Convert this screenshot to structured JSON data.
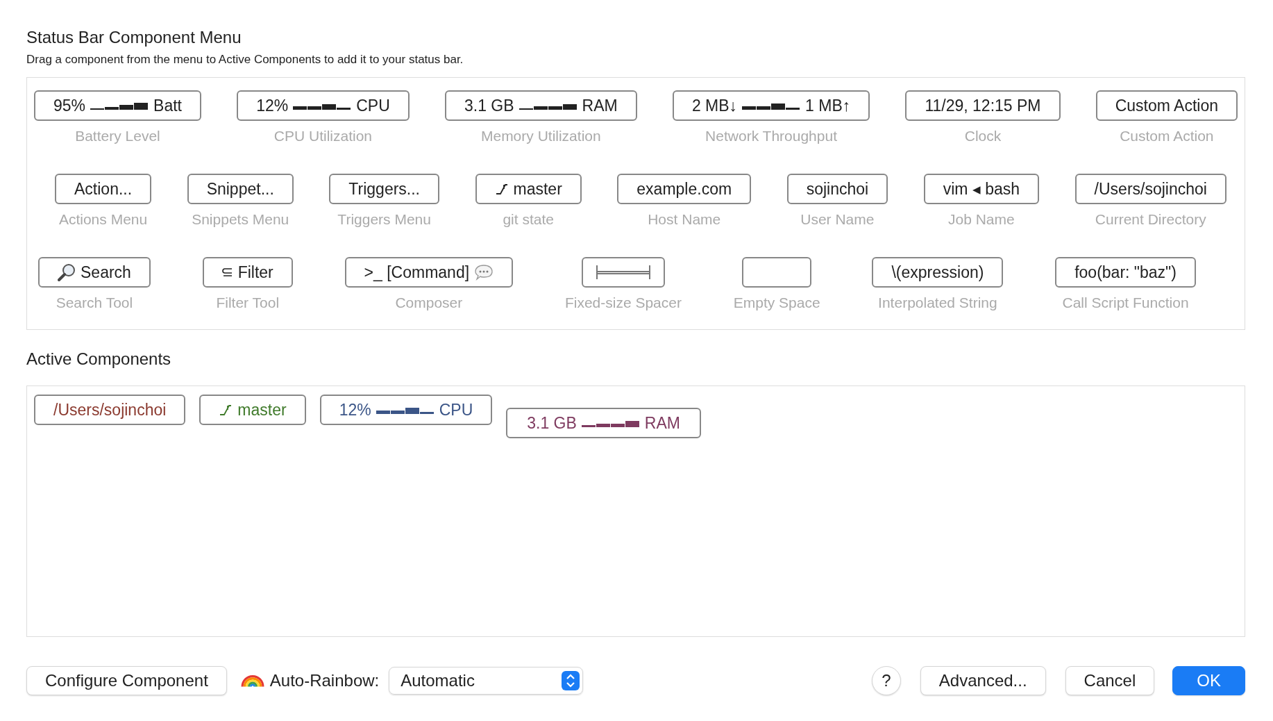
{
  "menu": {
    "title": "Status Bar Component Menu",
    "subtitle": "Drag a component from the menu to Active Components to add it to your status bar.",
    "components": [
      {
        "kind": "spark",
        "prefix": "95%",
        "suffix": "Batt",
        "caption": "Battery Level"
      },
      {
        "kind": "spark",
        "prefix": "12%",
        "suffix": "CPU",
        "caption": "CPU Utilization"
      },
      {
        "kind": "spark",
        "prefix": "3.1 GB",
        "suffix": "RAM",
        "caption": "Memory Utilization"
      },
      {
        "kind": "spark",
        "prefix": "2 MB↓",
        "suffix": "1 MB↑",
        "caption": "Network Throughput"
      },
      {
        "kind": "text",
        "text": "11/29, 12:15 PM",
        "caption": "Clock"
      },
      {
        "kind": "text",
        "text": "Custom Action",
        "caption": "Custom Action"
      },
      {
        "kind": "text",
        "text": "Action...",
        "caption": "Actions Menu"
      },
      {
        "kind": "text",
        "text": "Snippet...",
        "caption": "Snippets Menu"
      },
      {
        "kind": "text",
        "text": "Triggers...",
        "caption": "Triggers Menu"
      },
      {
        "kind": "git",
        "text": "master",
        "caption": "git state"
      },
      {
        "kind": "text",
        "text": "example.com",
        "caption": "Host Name"
      },
      {
        "kind": "text",
        "text": "sojinchoi",
        "caption": "User Name"
      },
      {
        "kind": "text",
        "text": "vim ◂ bash",
        "caption": "Job Name"
      },
      {
        "kind": "text",
        "text": "/Users/sojinchoi",
        "caption": "Current Directory"
      },
      {
        "kind": "search",
        "text": "Search",
        "caption": "Search Tool"
      },
      {
        "kind": "filter",
        "text": "Filter",
        "caption": "Filter Tool"
      },
      {
        "kind": "composer",
        "text": ">_ [Command]",
        "caption": "Composer"
      },
      {
        "kind": "spacer",
        "caption": "Fixed-size Spacer"
      },
      {
        "kind": "empty",
        "caption": "Empty Space"
      },
      {
        "kind": "text",
        "text": "\\(expression)",
        "caption": "Interpolated String"
      },
      {
        "kind": "text",
        "text": "foo(bar: \"baz\")",
        "caption": "Call Script Function"
      }
    ]
  },
  "active": {
    "title": "Active Components",
    "items": [
      {
        "kind": "text",
        "text": "/Users/sojinchoi",
        "color": "#8b3a2f"
      },
      {
        "kind": "git",
        "text": "master",
        "color": "#3f7a2a"
      },
      {
        "kind": "spark",
        "prefix": "12%",
        "suffix": "CPU",
        "color": "#3b5587"
      },
      {
        "kind": "spark",
        "prefix": "3.1 GB",
        "suffix": "RAM",
        "color": "#7e3a5f"
      }
    ]
  },
  "footer": {
    "configure": "Configure Component",
    "rainbow_label": "Auto-Rainbow:",
    "rainbow_value": "Automatic",
    "help": "?",
    "buttons": [
      {
        "label": "Advanced...",
        "primary": false
      },
      {
        "label": "Cancel",
        "primary": false
      },
      {
        "label": "OK",
        "primary": true
      }
    ]
  }
}
